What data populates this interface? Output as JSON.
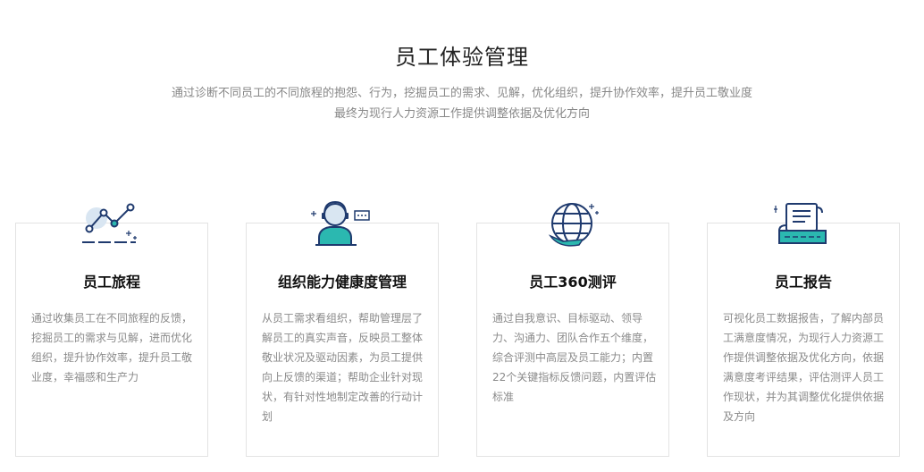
{
  "header": {
    "title": "员工体验管理",
    "subtitle_line1": "通过诊断不同员工的不同旅程的抱怨、行为，挖掘员工的需求、见解，优化组织，提升协作效率，提升员工敬业度",
    "subtitle_line2": "最终为现行人力资源工作提供调整依据及优化方向"
  },
  "cards": [
    {
      "icon": "journey-chart-icon",
      "title": "员工旅程",
      "desc": "通过收集员工在不同旅程的反馈，挖掘员工的需求与见解，进而优化组织，提升协作效率，提升员工敬业度，幸福感和生产力"
    },
    {
      "icon": "employee-avatar-icon",
      "title": "组织能力健康度管理",
      "desc": "从员工需求看组织，帮助管理层了解员工的真实声音，反映员工整体敬业状况及驱动因素，为员工提供向上反馈的渠道；帮助企业针对现状，有针对性地制定改善的行动计划"
    },
    {
      "icon": "globe-icon",
      "title": "员工360测评",
      "desc": "通过自我意识、目标驱动、领导力、沟通力、团队合作五个维度，综合评测中高层及员工能力；内置22个关键指标反馈问题，内置评估标准"
    },
    {
      "icon": "report-document-icon",
      "title": "员工报告",
      "desc": "可视化员工数据报告，了解内部员工满意度情况，为现行人力资源工作提供调整依据及优化方向，依据满意度考评结果，评估测评人员工作现状，并为其调整优化提供依据及方向"
    }
  ],
  "colors": {
    "icon_navy": "#1f3a6e",
    "icon_teal": "#2bb8b0",
    "icon_light": "#d9e6f2"
  }
}
